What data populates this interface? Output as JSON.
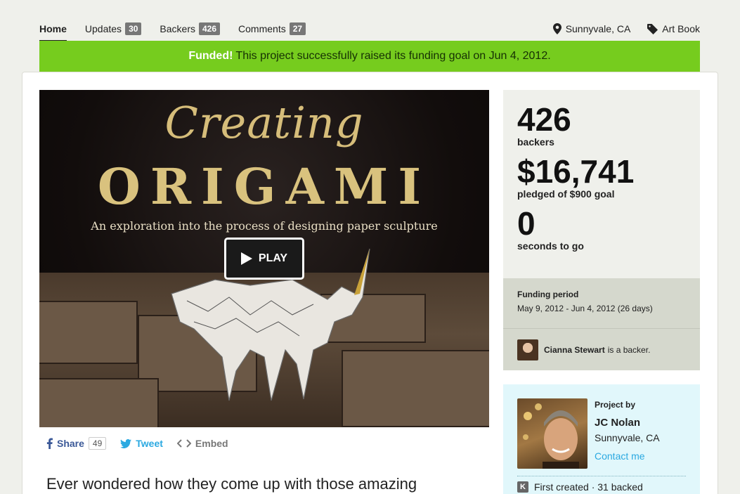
{
  "nav": {
    "tabs": [
      {
        "label": "Home",
        "count": null
      },
      {
        "label": "Updates",
        "count": "30"
      },
      {
        "label": "Backers",
        "count": "426"
      },
      {
        "label": "Comments",
        "count": "27"
      }
    ],
    "location": "Sunnyvale, CA",
    "category": "Art Book"
  },
  "banner": {
    "strong": "Funded!",
    "text": "This project successfully raised its funding goal on Jun 4, 2012."
  },
  "video": {
    "title_script": "Creating",
    "title_big": "ORIGAMI",
    "subtitle": "An exploration into the process of designing paper sculpture",
    "play_label": "PLAY"
  },
  "share": {
    "share_label": "Share",
    "share_count": "49",
    "tweet_label": "Tweet",
    "embed_label": "Embed"
  },
  "blurb": "Ever wondered how they come up with those amazing",
  "stats": {
    "backers_num": "426",
    "backers_label": "backers",
    "pledged_num": "$16,741",
    "pledged_label": "pledged of $900 goal",
    "time_num": "0",
    "time_label": "seconds to go"
  },
  "funding_period": {
    "title": "Funding period",
    "range": "May 9, 2012 - Jun 4, 2012 (26 days)"
  },
  "backer_note": {
    "name": "Cianna Stewart",
    "suffix": "is a backer."
  },
  "creator": {
    "by_label": "Project by",
    "name": "JC Nolan",
    "location": "Sunnyvale, CA",
    "contact": "Contact me",
    "history": "First created · 31 backed",
    "k_glyph": "K"
  },
  "colors": {
    "funded_green": "#76cc1e",
    "link_blue": "#2ba9e1",
    "facebook_blue": "#3b5998"
  }
}
